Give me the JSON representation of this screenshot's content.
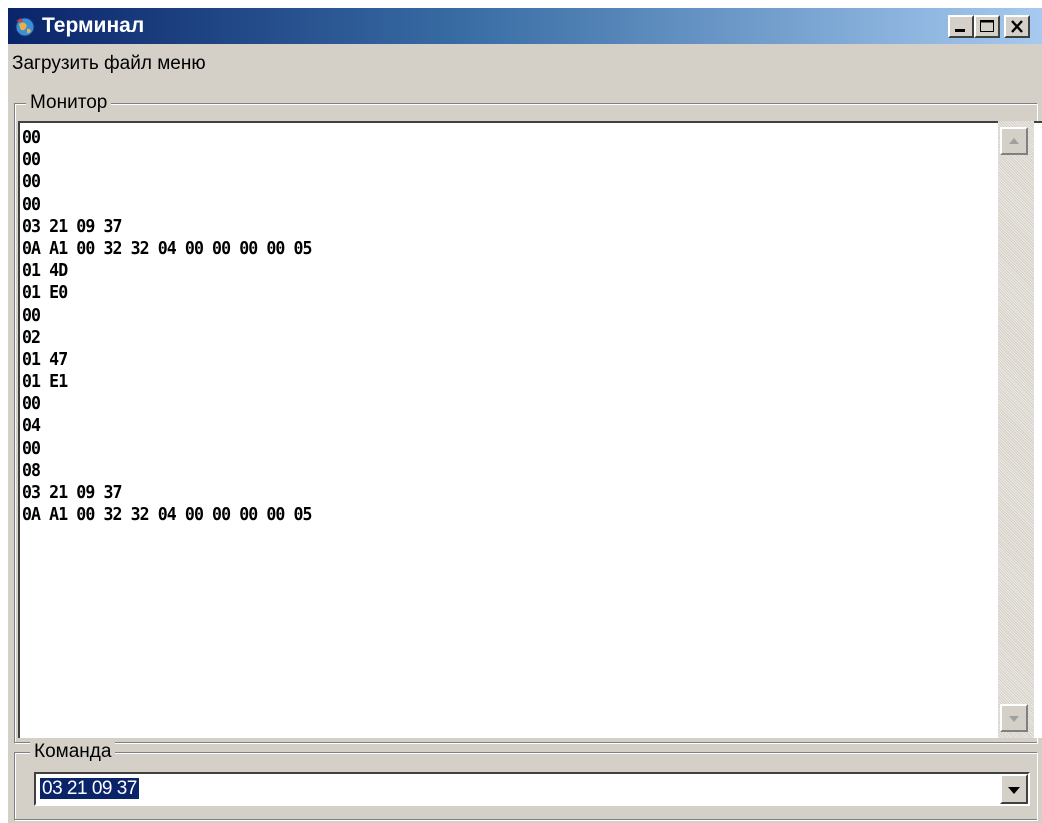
{
  "window": {
    "title": "Терминал",
    "icon": "app-globe-icon"
  },
  "titlebar_buttons": [
    "minimize-icon",
    "maximize-icon",
    "close-icon"
  ],
  "menu": {
    "items": [
      {
        "label": "Загрузить файл меню"
      }
    ]
  },
  "monitor": {
    "legend": "Монитор",
    "lines": [
      "00",
      "00",
      "00",
      "00",
      "03 21 09 37",
      "0A A1 00 32 32 04 00 00 00 00 05",
      "01 4D",
      "01 E0",
      "00",
      "02",
      "01 47",
      "01 E1",
      "00",
      "04",
      "00",
      "08",
      "03 21 09 37",
      "0A A1 00 32 32 04 00 00 00 00 05"
    ]
  },
  "command": {
    "legend": "Команда",
    "value": "03 21 09 37"
  },
  "colors": {
    "window_bg": "#d4d0c8",
    "titlebar_start": "#0a246a",
    "titlebar_end": "#a6caf0",
    "selection": "#0a246a"
  }
}
